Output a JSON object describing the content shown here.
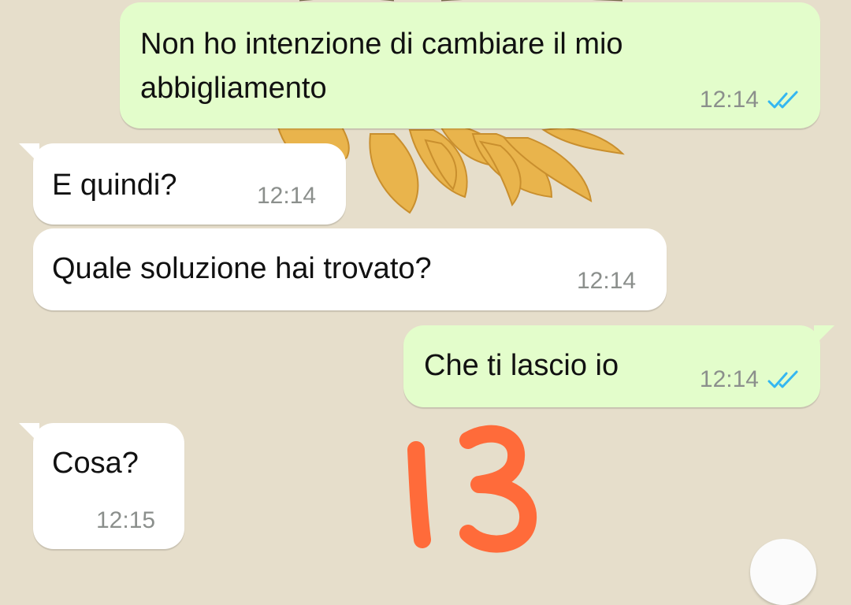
{
  "chat": {
    "messages": [
      {
        "direction": "outgoing",
        "text_line1": "Non ho intenzione di cambiare il mio",
        "text_line2": "abbigliamento",
        "time": "12:14",
        "status": "read"
      },
      {
        "direction": "incoming",
        "text": "E quindi?",
        "time": "12:14"
      },
      {
        "direction": "incoming",
        "text": "Quale soluzione hai trovato?",
        "time": "12:14"
      },
      {
        "direction": "outgoing",
        "text": "Che ti lascio io",
        "time": "12:14",
        "status": "read"
      },
      {
        "direction": "incoming",
        "text": "Cosa?",
        "time": "12:15"
      }
    ]
  },
  "annotation": {
    "text": "13",
    "color": "#ff6b3a"
  },
  "icons": {
    "read_receipt": "double-check-icon",
    "scroll_down": "scroll-down-button"
  },
  "colors": {
    "wallpaper": "#e6decb",
    "outgoing_bubble": "#e3fdcb",
    "incoming_bubble": "#ffffff",
    "read_ticks": "#34b7f1",
    "timestamp": "#8b8f8c"
  }
}
